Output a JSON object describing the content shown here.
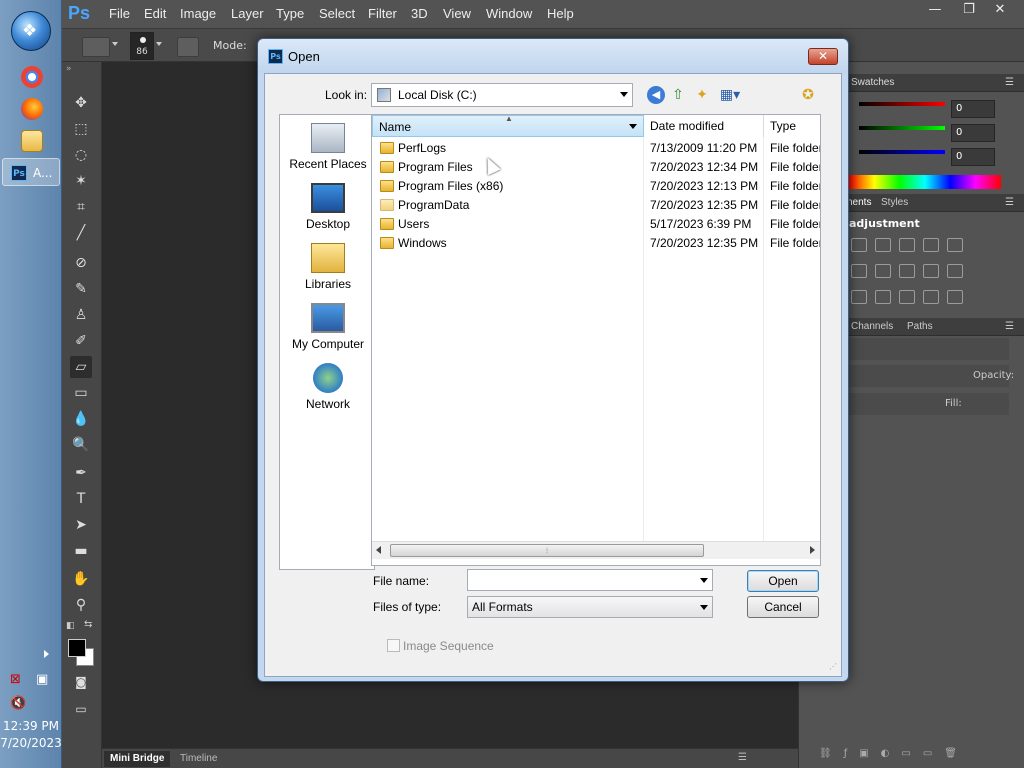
{
  "taskbar": {
    "clock_time": "12:39 PM",
    "clock_date": "7/20/2023",
    "active_app_label": "A...",
    "active_app_icon": "Ps"
  },
  "app": {
    "logo": "Ps",
    "menus": [
      "File",
      "Edit",
      "Image",
      "Layer",
      "Type",
      "Select",
      "Filter",
      "3D",
      "View",
      "Window",
      "Help"
    ],
    "window_controls": {
      "minimize": "—",
      "restore": "❐",
      "close": "✕"
    }
  },
  "options_bar": {
    "brush_size": "86",
    "mode_label": "Mode:"
  },
  "bottom_tabs": [
    "Mini Bridge",
    "Timeline"
  ],
  "right_panels": {
    "swatches_tab": "Swatches",
    "color_values": [
      "0",
      "0",
      "0"
    ],
    "adjustments_tabs": [
      "nents",
      "Styles"
    ],
    "adjustments_title": "adjustment",
    "layers_tabs": [
      "Channels",
      "Paths"
    ],
    "opacity_label": "Opacity:",
    "fill_label": "Fill:"
  },
  "dialog": {
    "title": "Open",
    "close_icon": "✕",
    "look_in_label": "Look in:",
    "look_in_value": "Local Disk (C:)",
    "places": [
      "Recent Places",
      "Desktop",
      "Libraries",
      "My Computer",
      "Network"
    ],
    "columns": {
      "name": "Name",
      "date": "Date modified",
      "type": "Type"
    },
    "files": [
      {
        "name": "PerfLogs",
        "date": "7/13/2009 11:20 PM",
        "type": "File folder"
      },
      {
        "name": "Program Files",
        "date": "7/20/2023 12:34 PM",
        "type": "File folder"
      },
      {
        "name": "Program Files (x86)",
        "date": "7/20/2023 12:13 PM",
        "type": "File folder"
      },
      {
        "name": "ProgramData",
        "date": "7/20/2023 12:35 PM",
        "type": "File folder"
      },
      {
        "name": "Users",
        "date": "5/17/2023 6:39 PM",
        "type": "File folder"
      },
      {
        "name": "Windows",
        "date": "7/20/2023 12:35 PM",
        "type": "File folder"
      }
    ],
    "file_name_label": "File name:",
    "file_name_value": "",
    "files_of_type_label": "Files of type:",
    "files_of_type_value": "All Formats",
    "open_button": "Open",
    "cancel_button": "Cancel",
    "image_sequence_label": "Image Sequence"
  },
  "colors": {
    "ps_blue": "#4aa6ff",
    "dialog_frame": "#c3d7ee",
    "taskbar": "#6d92ba"
  }
}
